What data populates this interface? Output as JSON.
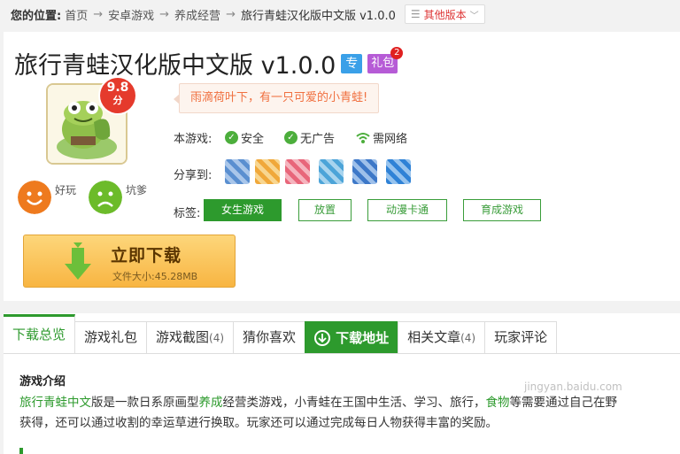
{
  "breadcrumb": {
    "label": "您的位置:",
    "items": [
      "首页",
      "安卓游戏",
      "养成经营",
      "旅行青蛙汉化版中文版 v1.0.0"
    ],
    "arrow": "→",
    "versions_button": "其他版本"
  },
  "app": {
    "title": "旅行青蛙汉化版中文版 v1.0.0",
    "badge_exclusive": "专",
    "badge_gift": "礼包",
    "gift_count": "2",
    "score": "9.8",
    "score_unit": "分",
    "slogan": "雨滴荷叶下，有一只可爱的小青蛙!",
    "vote_good": "好玩",
    "vote_bad": "坑爹",
    "features_label": "本游戏:",
    "features": [
      "安全",
      "无广告",
      "需网络"
    ],
    "share_label": "分享到:",
    "tags_label": "标签:",
    "tags": [
      "女生游戏",
      "放置",
      "动漫卡通",
      "育成游戏"
    ],
    "download_label": "立即下载",
    "file_size": "文件大小:45.28MB"
  },
  "tabs": [
    {
      "label": "下载总览",
      "count": ""
    },
    {
      "label": "游戏礼包",
      "count": ""
    },
    {
      "label": "游戏截图",
      "count": "(4)"
    },
    {
      "label": "猜你喜欢",
      "count": ""
    },
    {
      "label": "下载地址",
      "count": ""
    },
    {
      "label": "相关文章",
      "count": "(4)"
    },
    {
      "label": "玩家评论",
      "count": ""
    }
  ],
  "intro": {
    "title": "游戏介绍",
    "line1_hl1": "旅行青蛙中文",
    "line1_a": "版是一款日系原画型",
    "line1_hl2": "养成",
    "line1_b": "经营类游戏，小青蛙在王国中生活、学习、旅行，",
    "line1_hl3": "食物",
    "line1_c": "等需要通过自己在野",
    "line2": "获得，还可以通过收割的幸运草进行换取。玩家还可以通过完成每日人物获得丰富的奖励。"
  },
  "watermark": "jingyan.baidu.com",
  "colors": {
    "accent": "#2d9a2d",
    "score": "#e53a2c",
    "download": "#f8b542",
    "gift": "#b65bd6",
    "exclusive": "#3aa0e8"
  }
}
